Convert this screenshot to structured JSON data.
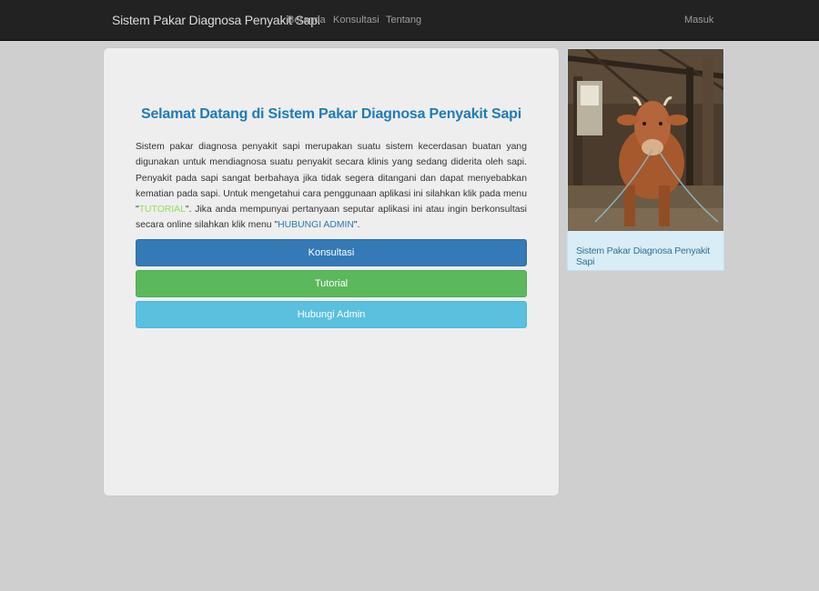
{
  "navbar": {
    "brand": "Sistem Pakar Diagnosa Penyakit Sapi",
    "links": [
      "Beranda",
      "Konsultasi",
      "Tentang"
    ],
    "login": "Masuk"
  },
  "main": {
    "title": "Selamat Datang di Sistem Pakar Diagnosa Penyakit Sapi",
    "intro_part1": "Sistem pakar diagnosa penyakit sapi merupakan suatu sistem kecerdasan buatan yang digunakan untuk mendiagnosa suatu penyakit secara klinis yang sedang diderita oleh sapi. Penyakit pada sapi sangat berbahaya jika tidak segera ditangani dan dapat menyebabkan kematian pada sapi. Untuk mengetahui cara penggunaan aplikasi ini silahkan klik pada menu \"",
    "intro_link1": "TUTORIAL",
    "intro_part2": "\". Jika anda mempunyai pertanyaan seputar aplikasi ini atau ingin berkonsultasi secara online silahkan klik menu \"",
    "intro_link2": "HUBUNGI ADMIN",
    "intro_part3": "\".",
    "buttons": {
      "consult": "Konsultasi",
      "tutorial": "Tutorial",
      "contact": "Hubungi Admin"
    }
  },
  "sidebar": {
    "caption": "Sistem Pakar Diagnosa Penyakit Sapi",
    "image_icon": "cow-photo"
  },
  "colors": {
    "primary": "#337ab7",
    "success": "#5cb85c",
    "info": "#5bc0de",
    "title": "#1f7bb8"
  }
}
